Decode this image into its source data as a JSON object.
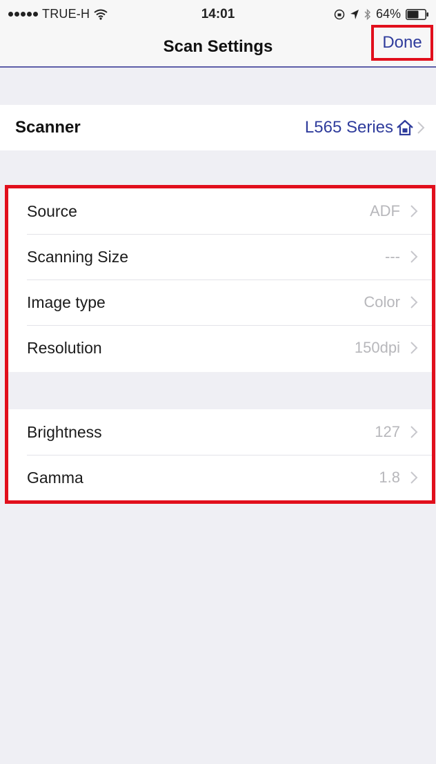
{
  "status_bar": {
    "carrier": "TRUE-H",
    "time": "14:01",
    "battery_percent": "64%",
    "battery_level": 0.64
  },
  "nav": {
    "title": "Scan Settings",
    "done_label": "Done"
  },
  "scanner": {
    "label": "Scanner",
    "value": "L565 Series"
  },
  "settings": {
    "group_a": [
      {
        "label": "Source",
        "value": "ADF"
      },
      {
        "label": "Scanning Size",
        "value": "---"
      },
      {
        "label": "Image type",
        "value": "Color"
      },
      {
        "label": "Resolution",
        "value": "150dpi"
      }
    ],
    "group_b": [
      {
        "label": "Brightness",
        "value": "127"
      },
      {
        "label": "Gamma",
        "value": "1.8"
      }
    ]
  },
  "colors": {
    "accent": "#2f3c9c",
    "highlight": "#e10f1c",
    "background": "#efeff4",
    "secondary_text": "#b7b7bb"
  },
  "icons": [
    "wifi-icon",
    "location-arrow-icon",
    "bluetooth-icon",
    "battery-icon",
    "home-icon",
    "chevron-right-icon",
    "orientation-lock-icon"
  ]
}
